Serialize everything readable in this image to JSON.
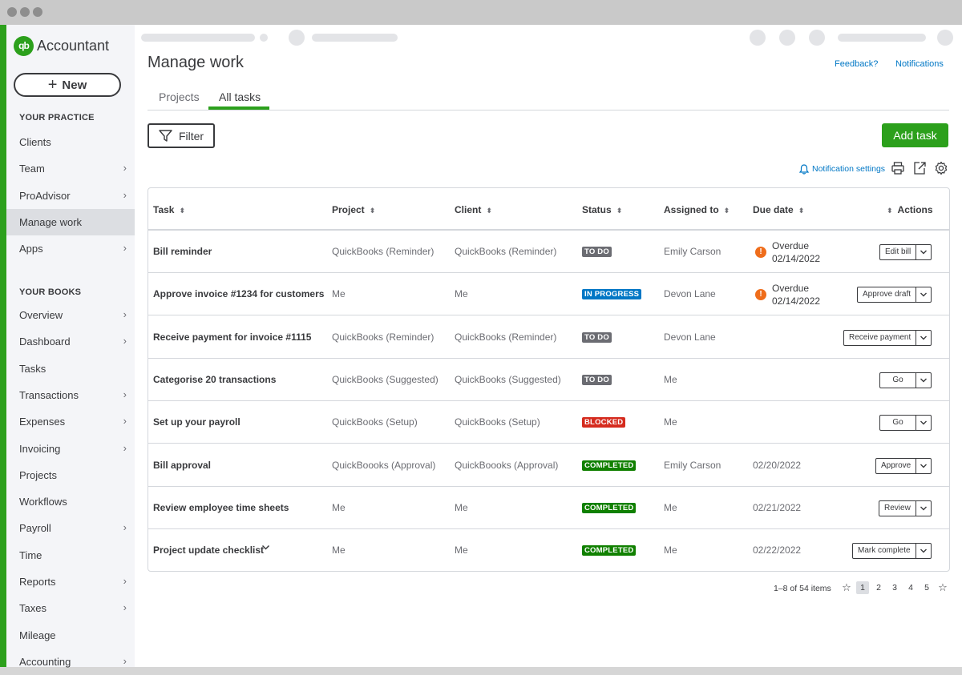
{
  "app": {
    "logo_mark": "qb",
    "logo_text": "Accountant",
    "new_button": "New"
  },
  "sidebar": {
    "practice_label": "YOUR PRACTICE",
    "practice_items": [
      {
        "label": "Clients",
        "chevron": false
      },
      {
        "label": "Team",
        "chevron": true
      },
      {
        "label": "ProAdvisor",
        "chevron": true
      },
      {
        "label": "Manage work",
        "chevron": false,
        "active": true
      },
      {
        "label": "Apps",
        "chevron": true
      }
    ],
    "books_label": "YOUR BOOKS",
    "books_items": [
      {
        "label": "Overview",
        "chevron": true
      },
      {
        "label": "Dashboard",
        "chevron": true
      },
      {
        "label": "Tasks",
        "chevron": false
      },
      {
        "label": "Transactions",
        "chevron": true
      },
      {
        "label": "Expenses",
        "chevron": true
      },
      {
        "label": "Invoicing",
        "chevron": true
      },
      {
        "label": "Projects",
        "chevron": false
      },
      {
        "label": "Workflows",
        "chevron": false
      },
      {
        "label": "Payroll",
        "chevron": true
      },
      {
        "label": "Time",
        "chevron": false
      },
      {
        "label": "Reports",
        "chevron": true
      },
      {
        "label": "Taxes",
        "chevron": true
      },
      {
        "label": "Mileage",
        "chevron": false
      },
      {
        "label": "Accounting",
        "chevron": true
      }
    ]
  },
  "header": {
    "title": "Manage work",
    "feedback_link": "Feedback?",
    "notifications_link": "Notifications",
    "tabs": [
      {
        "label": "Projects",
        "active": false
      },
      {
        "label": "All tasks",
        "active": true
      }
    ]
  },
  "toolbar": {
    "filter_label": "Filter",
    "add_task_label": "Add task",
    "notification_settings": "Notification settings"
  },
  "table": {
    "columns": {
      "task": "Task",
      "project": "Project",
      "client": "Client",
      "status": "Status",
      "assigned": "Assigned to",
      "due": "Due date",
      "actions": "Actions"
    },
    "rows": [
      {
        "task": "Bill reminder",
        "project": "QuickBooks (Reminder)",
        "client": "QuickBooks (Reminder)",
        "status": "TO DO",
        "assigned": "Emily Carson",
        "overdue": true,
        "overdue_label": "Overdue",
        "due": "02/14/2022",
        "action": "Edit bill"
      },
      {
        "task": "Approve invoice #1234 for customers",
        "project": "Me",
        "client": "Me",
        "status": "IN PROGRESS",
        "assigned": "Devon Lane",
        "overdue": true,
        "overdue_label": "Overdue",
        "due": "02/14/2022",
        "action": "Approve draft"
      },
      {
        "task": "Receive payment for invoice #1115",
        "project": "QuickBooks (Reminder)",
        "client": "QuickBooks (Reminder)",
        "status": "TO DO",
        "assigned": "Devon Lane",
        "overdue": false,
        "overdue_label": "",
        "due": "",
        "action": "Receive payment"
      },
      {
        "task": "Categorise 20 transactions",
        "project": "QuickBooks (Suggested)",
        "client": "QuickBooks (Suggested)",
        "status": "TO DO",
        "assigned": "Me",
        "overdue": false,
        "overdue_label": "",
        "due": "",
        "action": "Go"
      },
      {
        "task": "Set up your payroll",
        "project": "QuickBooks (Setup)",
        "client": "QuickBooks (Setup)",
        "status": "BLOCKED",
        "assigned": "Me",
        "overdue": false,
        "overdue_label": "",
        "due": "",
        "action": "Go"
      },
      {
        "task": "Bill approval",
        "project": "QuickBoooks (Approval)",
        "client": "QuickBoooks (Approval)",
        "status": "COMPLETED",
        "assigned": "Emily Carson",
        "overdue": false,
        "overdue_label": "",
        "due": "02/20/2022",
        "action": "Approve"
      },
      {
        "task": "Review employee time sheets",
        "project": "Me",
        "client": "Me",
        "status": "COMPLETED",
        "assigned": "Me",
        "overdue": false,
        "overdue_label": "",
        "due": "02/21/2022",
        "action": "Review"
      },
      {
        "task": "Project update checklist",
        "project": "Me",
        "client": "Me",
        "status": "COMPLETED",
        "assigned": "Me",
        "overdue": false,
        "overdue_label": "",
        "due": "02/22/2022",
        "action": "Mark complete",
        "expandable": true
      }
    ]
  },
  "status_colors": {
    "TO DO": "#6b6c72",
    "IN PROGRESS": "#0077c5",
    "BLOCKED": "#d52b1e",
    "COMPLETED": "#108000"
  },
  "pagination": {
    "summary": "1–8 of 54 items",
    "pages": [
      "1",
      "2",
      "3",
      "4",
      "5"
    ],
    "current": "1"
  },
  "colors": {
    "brand_green": "#2ca01c",
    "link_blue": "#0077c5",
    "overdue_orange": "#ef6d1b"
  }
}
